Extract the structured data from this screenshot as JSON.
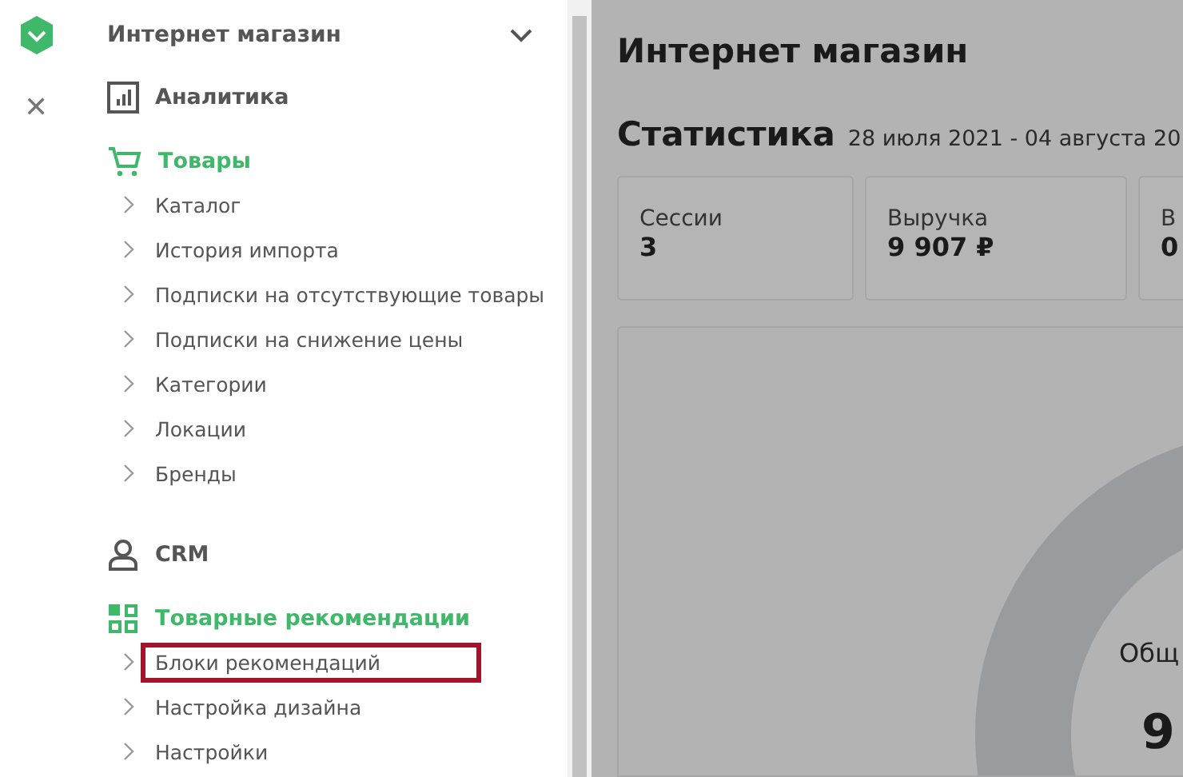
{
  "rail": {
    "close": "✕"
  },
  "sidebar": {
    "title": "Интернет магазин",
    "sections": [
      {
        "kind": "analytics",
        "label": "Аналитика",
        "expanded": false
      },
      {
        "kind": "cart",
        "label": "Товары",
        "expanded": true,
        "items": [
          {
            "label": "Каталог",
            "highlighted": false
          },
          {
            "label": "История импорта",
            "highlighted": false
          },
          {
            "label": "Подписки на отсутствующие товары",
            "highlighted": false
          },
          {
            "label": "Подписки на снижение цены",
            "highlighted": false
          },
          {
            "label": "Категории",
            "highlighted": false
          },
          {
            "label": "Локации",
            "highlighted": false
          },
          {
            "label": "Бренды",
            "highlighted": false
          }
        ]
      },
      {
        "kind": "user",
        "label": "CRM",
        "expanded": false
      },
      {
        "kind": "grid",
        "label": "Товарные рекомендации",
        "expanded": true,
        "items": [
          {
            "label": "Блоки рекомендаций",
            "highlighted": true
          },
          {
            "label": "Настройка дизайна",
            "highlighted": false
          },
          {
            "label": "Настройки",
            "highlighted": false
          }
        ]
      }
    ]
  },
  "main": {
    "title": "Интернет магазин",
    "stats_title": "Статистика",
    "date_range": "28 июля 2021 - 04 августа 20",
    "cards": [
      {
        "label": "Сессии",
        "value": "3"
      },
      {
        "label": "Выручка",
        "value": "9 907 ₽"
      },
      {
        "label": "В",
        "value": "0"
      }
    ],
    "donut": {
      "label": "Общ",
      "value": "9"
    }
  }
}
